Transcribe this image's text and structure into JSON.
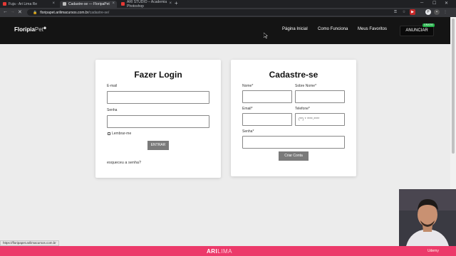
{
  "browser": {
    "tabs": [
      {
        "label": "Fuja - Ari Lima Re",
        "color": "#e53935"
      },
      {
        "label": "Cadastre-se — FloripaPet",
        "color": "#bdbdbd"
      },
      {
        "label": "ARI STUDIO – Academia Photoshop",
        "color": "#e53935"
      }
    ],
    "url_host": "floripapet.arilimacursos.com.br",
    "url_path": "/cadastre-se/"
  },
  "site": {
    "logo_main": "Floripia",
    "logo_sub": "Pet",
    "nav": [
      "Página Inicial",
      "Como Funciona",
      "Meus Favoritos"
    ],
    "cta": "ANUNCIAR",
    "cta_badge": "GRATIS"
  },
  "login": {
    "title": "Fazer Login",
    "email_label": "E-mail",
    "password_label": "Senha",
    "remember_label": "Lembrar-me",
    "submit": "ENTRAR",
    "forgot": "esqueceu a senha?"
  },
  "signup": {
    "title": "Cadastre-se",
    "name_label": "Nome*",
    "surname_label": "Sobre Nome*",
    "email_label": "Email*",
    "phone_label": "Telefone*",
    "phone_placeholder": "(**) * ****-****",
    "password_label": "Senha*",
    "submit": "Criar Conta"
  },
  "status_url": "https://floripapet.arilimacursos.com.br",
  "footer": {
    "brand_a": "ARI",
    "brand_b": "LIMA",
    "udemy": "Udemy"
  }
}
